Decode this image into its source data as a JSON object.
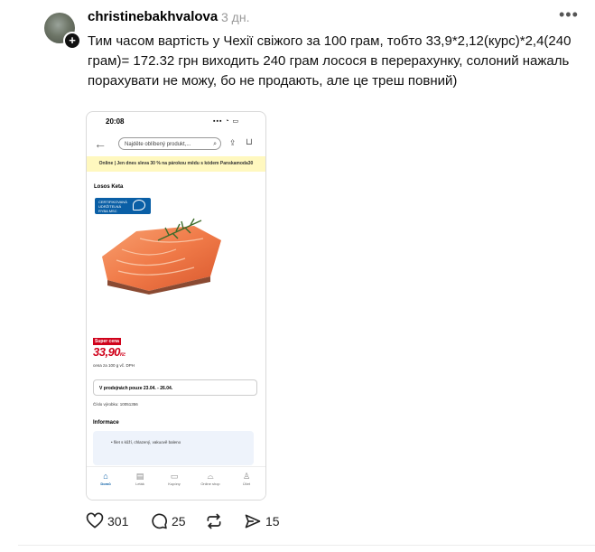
{
  "post": {
    "username": "christinebakhvalova",
    "time": "3 дн.",
    "more": "•••",
    "text": "Тим часом вартість у Чехії свіжого за 100 грам, тобто 33,9*2,12(курс)*2,4(240 грам)= 172.32 грн виходить 240 грам лосося в перерахунку, солоний нажаль порахувати не можу, бо не продають, але це треш повний)"
  },
  "screenshot": {
    "status_time": "20:08",
    "status_icons": "▪▪▪ ◔ ▭",
    "search_placeholder": "Najděte oblíbený produkt,...",
    "banner": "Online | Jen dnes sleva 30 % na párokou mědu s kódem Panskamoda30",
    "product_title": "Losos Keta",
    "msc_label": "CERTIFIKOVANÁ UDRŽITELNÁ RYBA MSC",
    "badge": "Super cena",
    "price": "33,90",
    "price_suffix": "Kč",
    "per_unit": "cena za 100 g vč. DPH",
    "availability": "V prodejnách pouze 23.04. - 26.04.",
    "product_code": "Číslo výrobku: 10051356",
    "info_heading": "Informace",
    "info_bullet": "• filet s kůží, chlazený, vakuově balenо",
    "nav": [
      {
        "label": "Domů",
        "icon": "home-icon"
      },
      {
        "label": "Leták",
        "icon": "leaflet-icon"
      },
      {
        "label": "Kupóny",
        "icon": "coupon-icon"
      },
      {
        "label": "Online shop",
        "icon": "bag-icon"
      },
      {
        "label": "Účet",
        "icon": "account-icon"
      }
    ]
  },
  "actions": {
    "likes": "301",
    "comments": "25",
    "shares": "15"
  },
  "colors": {
    "price_red": "#d0021b",
    "msc_blue": "#0a5fa6",
    "banner_yellow": "#fff8bf",
    "muted": "#999999"
  }
}
